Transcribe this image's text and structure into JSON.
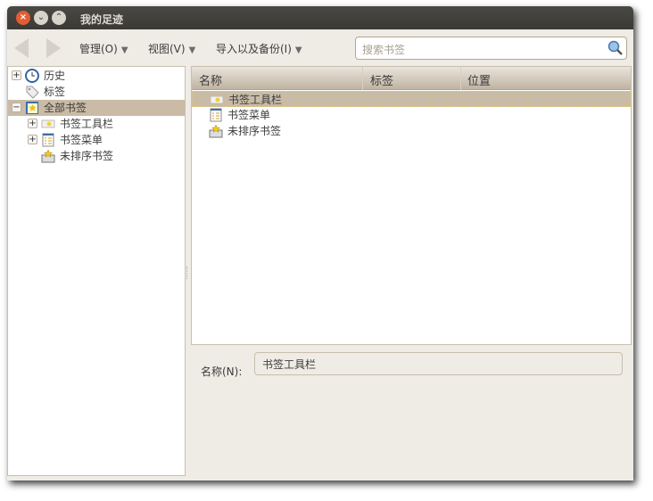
{
  "window": {
    "title": "我的足迹"
  },
  "toolbar": {
    "menus": [
      {
        "label": "管理(O)"
      },
      {
        "label": "视图(V)"
      },
      {
        "label": "导入以及备份(I)"
      }
    ],
    "search_placeholder": "搜索书签"
  },
  "sidebar": {
    "items": [
      {
        "label": "历史",
        "icon": "clock-icon",
        "expander": "+"
      },
      {
        "label": "标签",
        "icon": "tag-icon",
        "expander": ""
      },
      {
        "label": "全部书签",
        "icon": "bookmarks-icon",
        "expander": "−",
        "selected": true
      },
      {
        "label": "书签工具栏",
        "icon": "bookmark-toolbar-icon",
        "expander": "+"
      },
      {
        "label": "书签菜单",
        "icon": "bookmark-menu-icon",
        "expander": "+"
      },
      {
        "label": "未排序书签",
        "icon": "unsorted-bookmarks-icon",
        "expander": ""
      }
    ]
  },
  "list": {
    "columns": [
      "名称",
      "标签",
      "位置"
    ],
    "rows": [
      {
        "name": "书签工具栏",
        "selected": true
      },
      {
        "name": "书签菜单"
      },
      {
        "name": "未排序书签"
      }
    ]
  },
  "details": {
    "name_label": "名称(N):",
    "name_value": "书签工具栏"
  },
  "colors": {
    "selection": "#c9bba6",
    "titlebar": "#3c3b37",
    "close": "#e25d33"
  }
}
